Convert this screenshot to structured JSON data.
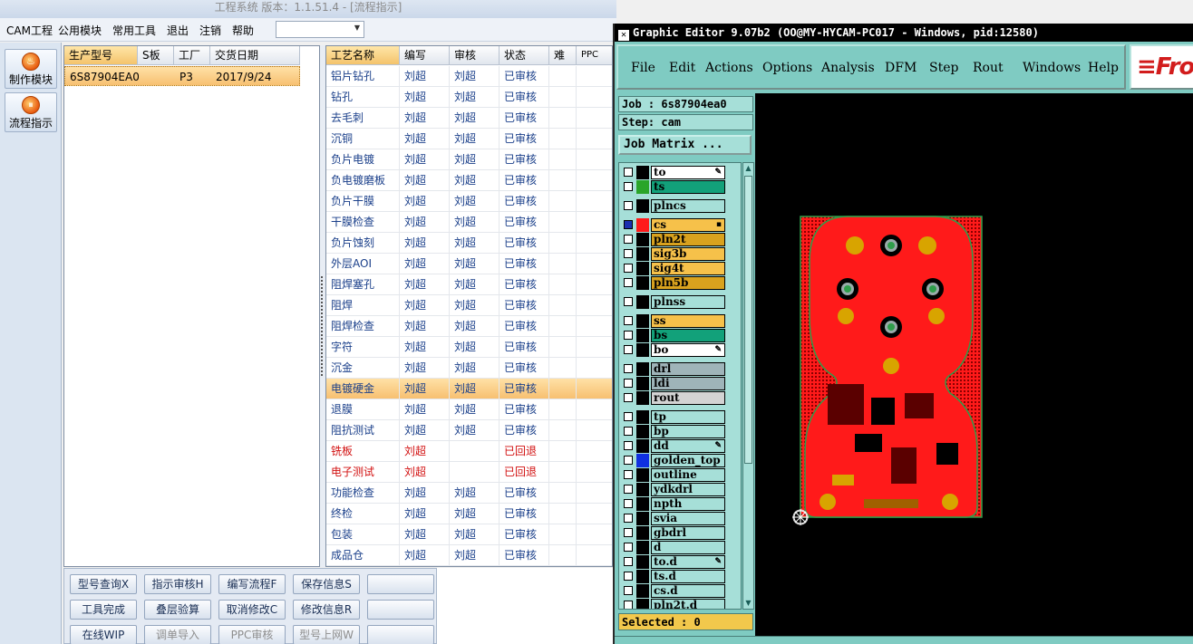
{
  "app": {
    "title": "工程系统 版本：1.1.51.4 - [流程指示]"
  },
  "menu": {
    "items": [
      "CAM工程",
      "公用模块",
      "常用工具",
      "退出",
      "注销",
      "帮助"
    ],
    "combo_value": ""
  },
  "nav": {
    "items": [
      "制作模块",
      "流程指示"
    ]
  },
  "left_grid": {
    "headers": [
      "生产型号",
      "S板",
      "工厂",
      "交货日期"
    ],
    "rows": [
      {
        "model": "6S87904EA0",
        "sboard": "",
        "factory": "P3",
        "date": "2017/9/24"
      }
    ]
  },
  "right_grid": {
    "headers": [
      "工艺名称",
      "编写",
      "审核",
      "状态",
      "难",
      "PPC"
    ],
    "rows": [
      {
        "name": "铝片钻孔",
        "writer": "刘超",
        "reviewer": "刘超",
        "status": "已审核"
      },
      {
        "name": "钻孔",
        "writer": "刘超",
        "reviewer": "刘超",
        "status": "已审核"
      },
      {
        "name": "去毛刺",
        "writer": "刘超",
        "reviewer": "刘超",
        "status": "已审核"
      },
      {
        "name": "沉铜",
        "writer": "刘超",
        "reviewer": "刘超",
        "status": "已审核"
      },
      {
        "name": "负片电镀",
        "writer": "刘超",
        "reviewer": "刘超",
        "status": "已审核"
      },
      {
        "name": "负电镀磨板",
        "writer": "刘超",
        "reviewer": "刘超",
        "status": "已审核"
      },
      {
        "name": "负片干膜",
        "writer": "刘超",
        "reviewer": "刘超",
        "status": "已审核"
      },
      {
        "name": "干膜检查",
        "writer": "刘超",
        "reviewer": "刘超",
        "status": "已审核"
      },
      {
        "name": "负片蚀刻",
        "writer": "刘超",
        "reviewer": "刘超",
        "status": "已审核"
      },
      {
        "name": "外层AOI",
        "writer": "刘超",
        "reviewer": "刘超",
        "status": "已审核"
      },
      {
        "name": "阻焊塞孔",
        "writer": "刘超",
        "reviewer": "刘超",
        "status": "已审核"
      },
      {
        "name": "阻焊",
        "writer": "刘超",
        "reviewer": "刘超",
        "status": "已审核"
      },
      {
        "name": "阻焊检查",
        "writer": "刘超",
        "reviewer": "刘超",
        "status": "已审核"
      },
      {
        "name": "字符",
        "writer": "刘超",
        "reviewer": "刘超",
        "status": "已审核"
      },
      {
        "name": "沉金",
        "writer": "刘超",
        "reviewer": "刘超",
        "status": "已审核"
      },
      {
        "name": "电镀硬金",
        "writer": "刘超",
        "reviewer": "刘超",
        "status": "已审核",
        "selected": true
      },
      {
        "name": "退膜",
        "writer": "刘超",
        "reviewer": "刘超",
        "status": "已审核"
      },
      {
        "name": "阻抗测试",
        "writer": "刘超",
        "reviewer": "刘超",
        "status": "已审核"
      },
      {
        "name": "铣板",
        "writer": "刘超",
        "reviewer": "",
        "status": "已回退",
        "returned": true
      },
      {
        "name": "电子测试",
        "writer": "刘超",
        "reviewer": "",
        "status": "已回退",
        "returned": true
      },
      {
        "name": "功能检查",
        "writer": "刘超",
        "reviewer": "刘超",
        "status": "已审核"
      },
      {
        "name": "终检",
        "writer": "刘超",
        "reviewer": "刘超",
        "status": "已审核"
      },
      {
        "name": "包装",
        "writer": "刘超",
        "reviewer": "刘超",
        "status": "已审核"
      },
      {
        "name": "成品仓",
        "writer": "刘超",
        "reviewer": "刘超",
        "status": "已审核"
      }
    ]
  },
  "actions": {
    "buttons": [
      {
        "label": "型号查询X",
        "disabled": false
      },
      {
        "label": "指示审核H",
        "disabled": false
      },
      {
        "label": "编写流程F",
        "disabled": false
      },
      {
        "label": "保存信息S",
        "disabled": false
      },
      {
        "label": "",
        "disabled": false
      },
      {
        "label": "工具完成",
        "disabled": false
      },
      {
        "label": "叠层验算",
        "disabled": false
      },
      {
        "label": "取消修改C",
        "disabled": false
      },
      {
        "label": "修改信息R",
        "disabled": false
      },
      {
        "label": "",
        "disabled": false
      },
      {
        "label": "在线WIP",
        "disabled": false
      },
      {
        "label": "调单导入",
        "disabled": true
      },
      {
        "label": "PPC审核",
        "disabled": true
      },
      {
        "label": "型号上网W",
        "disabled": true
      },
      {
        "label": "",
        "disabled": false
      }
    ]
  },
  "editor": {
    "title": "Graphic Editor 9.07b2 (OO@MY-HYCAM-PC017 - Windows, pid:12580)",
    "menu": [
      "File",
      "Edit",
      "Actions",
      "Options",
      "Analysis",
      "DFM",
      "Step",
      "Rout",
      "Windows",
      "Help"
    ],
    "logo": "Fro",
    "job": "Job : 6s87904ea0",
    "step": "Step: cam",
    "job_matrix": "Job Matrix ...",
    "selected": "Selected : 0",
    "colors": {
      "board": "#ff1a1a",
      "canvas": "#000000",
      "panel": "#7fcbc2",
      "outline_green": "#2e9e4a"
    },
    "layers": [
      {
        "name": "to",
        "bg": "#ffffff",
        "swatch": "#000000",
        "mark": "✎"
      },
      {
        "name": "ts",
        "bg": "#12a17a",
        "swatch": "#2aa52a"
      },
      {
        "name": "plncs",
        "bg": "#a6dfd8",
        "swatch": "#000000",
        "gap": true
      },
      {
        "name": "cs",
        "bg": "#f6c14a",
        "swatch": "#ff1a1a",
        "mark": "▪",
        "gap": true,
        "active": true
      },
      {
        "name": "pln2t",
        "bg": "#d9a21e",
        "swatch": "#000000"
      },
      {
        "name": "sig3b",
        "bg": "#f6c14a",
        "swatch": "#000000"
      },
      {
        "name": "sig4t",
        "bg": "#f6c14a",
        "swatch": "#000000"
      },
      {
        "name": "pln5b",
        "bg": "#d9a21e",
        "swatch": "#000000"
      },
      {
        "name": "plnss",
        "bg": "#a6dfd8",
        "swatch": "#000000",
        "gap": true
      },
      {
        "name": "ss",
        "bg": "#f6c14a",
        "swatch": "#000000",
        "gap": true
      },
      {
        "name": "bs",
        "bg": "#12a17a",
        "swatch": "#000000"
      },
      {
        "name": "bo",
        "bg": "#ffffff",
        "swatch": "#000000",
        "mark": "✎"
      },
      {
        "name": "drl",
        "bg": "#9fb4b9",
        "swatch": "#000000",
        "gap": true
      },
      {
        "name": "ldi",
        "bg": "#9fb4b9",
        "swatch": "#000000"
      },
      {
        "name": "rout",
        "bg": "#d3d3d3",
        "swatch": "#000000"
      },
      {
        "name": "tp",
        "bg": "#a6dfd8",
        "swatch": "#000000",
        "gap": true
      },
      {
        "name": "bp",
        "bg": "#a6dfd8",
        "swatch": "#000000"
      },
      {
        "name": "dd",
        "bg": "#a6dfd8",
        "swatch": "#000000",
        "mark": "✎"
      },
      {
        "name": "golden_top",
        "bg": "#a6dfd8",
        "swatch": "#1030e0"
      },
      {
        "name": "outline",
        "bg": "#a6dfd8",
        "swatch": "#000000"
      },
      {
        "name": "ydkdrl",
        "bg": "#a6dfd8",
        "swatch": "#000000"
      },
      {
        "name": "npth",
        "bg": "#a6dfd8",
        "swatch": "#000000"
      },
      {
        "name": "svia",
        "bg": "#a6dfd8",
        "swatch": "#000000"
      },
      {
        "name": "gbdrl",
        "bg": "#a6dfd8",
        "swatch": "#000000"
      },
      {
        "name": "d",
        "bg": "#a6dfd8",
        "swatch": "#000000"
      },
      {
        "name": "to.d",
        "bg": "#a6dfd8",
        "swatch": "#000000",
        "mark": "✎"
      },
      {
        "name": "ts.d",
        "bg": "#a6dfd8",
        "swatch": "#000000"
      },
      {
        "name": "cs.d",
        "bg": "#a6dfd8",
        "swatch": "#000000"
      },
      {
        "name": "pln2t.d",
        "bg": "#a6dfd8",
        "swatch": "#000000"
      }
    ]
  }
}
